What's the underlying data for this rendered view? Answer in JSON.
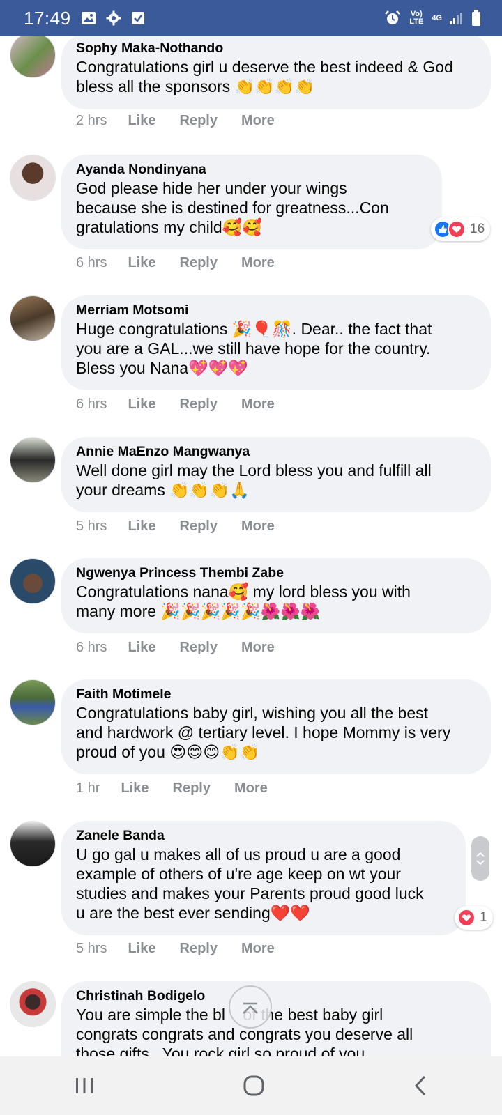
{
  "status_bar": {
    "time": "17:49",
    "left_icons": [
      "image-icon",
      "gear-icon",
      "checkbox-icon"
    ],
    "volte": "Vo) LTE",
    "network": "4G",
    "right_icons": [
      "alarm-icon",
      "signal-icon",
      "battery-icon"
    ]
  },
  "comments": [
    {
      "author": "Sophy Maka-Nothando",
      "text_lines": [
        "Congratulations girl u deserve the best indeed & God",
        "bless all the sponsors 👏👏👏👏"
      ],
      "time": "2 hrs",
      "like": "Like",
      "reply": "Reply",
      "more": "More"
    },
    {
      "author": "Ayanda Nondinyana",
      "text_lines": [
        "God please hide her under your wings",
        "because she is destined for greatness...Con",
        "gratulations my child🥰🥰"
      ],
      "time": "6 hrs",
      "like": "Like",
      "reply": "Reply",
      "more": "More",
      "reaction_count": "16"
    },
    {
      "author": "Merriam Motsomi",
      "text_lines": [
        "Huge congratulations 🎉🎈🎊. Dear.. the fact that",
        "you are a GAL...we still have hope for the country.",
        "Bless you Nana💖💖💖"
      ],
      "time": "6 hrs",
      "like": "Like",
      "reply": "Reply",
      "more": "More"
    },
    {
      "author": "Annie MaEnzo Mangwanya",
      "text_lines": [
        "Well done girl may the Lord bless you and fulfill all",
        "your dreams 👏👏👏🙏"
      ],
      "time": "5 hrs",
      "like": "Like",
      "reply": "Reply",
      "more": "More"
    },
    {
      "author": "Ngwenya Princess Thembi Zabe",
      "text_lines": [
        "Congratulations nana🥰 my lord bless you with",
        "many more 🎉🎉🎉🎉🎉🌺🌺🌺"
      ],
      "time": "6 hrs",
      "like": "Like",
      "reply": "Reply",
      "more": "More"
    },
    {
      "author": "Faith Motimele",
      "text_lines": [
        "Congratulations baby girl, wishing you all the best",
        "and hardwork @ tertiary level. I hope Mommy is very",
        "proud of you 😍😊😊👏👏"
      ],
      "time": "1 hr",
      "like": "Like",
      "reply": "Reply",
      "more": "More"
    },
    {
      "author": "Zanele Banda",
      "text_lines": [
        "U go gal u makes all of us proud u are a good",
        "example of others of u're age keep on wt your",
        "studies and makes your Parents proud good luck",
        "u are the best ever sending❤️❤️"
      ],
      "time": "5 hrs",
      "like": "Like",
      "reply": "Reply",
      "more": "More",
      "reaction_count": "1"
    },
    {
      "author": "Christinah Bodigelo",
      "text_lines": [
        "You are simple the bl    of the best baby girl",
        "congrats congrats and congrats you deserve all",
        "those gifts.. You rock girl so proud of you"
      ]
    }
  ],
  "colors": {
    "status_bar": "#3b5a9a",
    "bubble": "#f0f2f5",
    "meta_text": "#8a8d91",
    "like_blue": "#1877f2",
    "love_red": "#f33e58"
  }
}
